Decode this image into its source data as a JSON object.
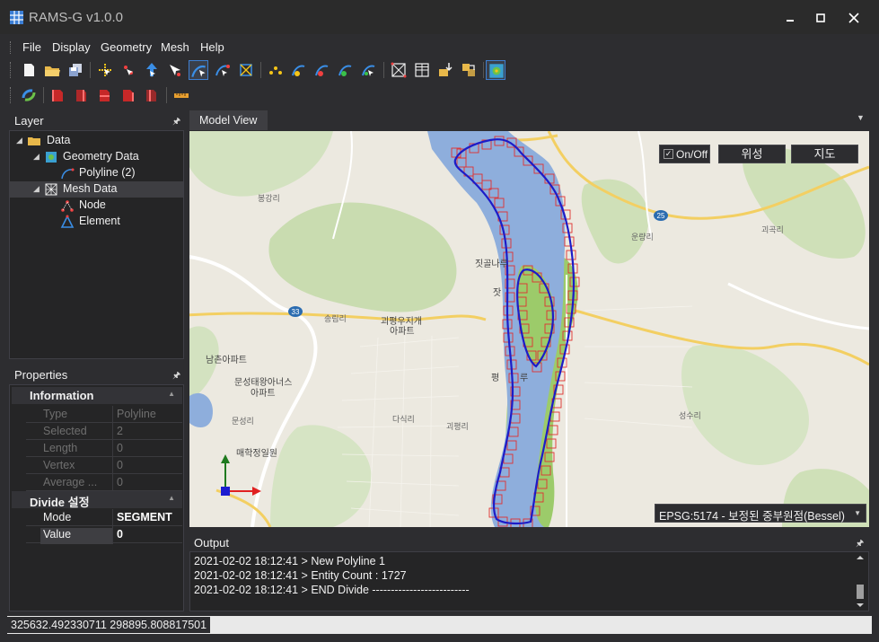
{
  "app": {
    "title": "RAMS-G v1.0.0",
    "window_controls": {
      "minimize": "minimize",
      "maximize": "maximize",
      "close": "close"
    }
  },
  "menu": {
    "file": "File",
    "display": "Display",
    "geometry": "Geometry",
    "mesh": "Mesh",
    "help": "Help"
  },
  "toolbar_icons_row1": [
    "new-file-icon",
    "open-folder-icon",
    "save-icon",
    "select-vertex-icon",
    "move-vertex-icon",
    "add-vertex-icon",
    "select-arrow-icon",
    "polyline-tool-icon",
    "edit-polyline-icon",
    "transform-icon",
    "node-add-icon",
    "curve-a-icon",
    "curve-b-icon",
    "curve-c-icon",
    "curve-d-icon",
    "grid-mesh-icon",
    "grid-refine-icon",
    "mesh-import-icon",
    "mesh-export-icon",
    "map-icon"
  ],
  "toolbar_icons_row2": [
    "refresh-icon",
    "red-box-1-icon",
    "red-box-2-icon",
    "red-box-3-icon",
    "red-box-4-icon",
    "red-box-5-icon",
    "ruler-icon"
  ],
  "layer_panel": {
    "title": "Layer",
    "tree": {
      "data": "Data",
      "geometry_data": "Geometry Data",
      "polyline": "Polyline (2)",
      "mesh_data": "Mesh Data",
      "node": "Node",
      "element": "Element"
    }
  },
  "properties_panel": {
    "title": "Properties",
    "information": {
      "label": "Information",
      "rows": [
        {
          "key": "Type",
          "value": "Polyline"
        },
        {
          "key": "Selected",
          "value": "2"
        },
        {
          "key": "Length",
          "value": "0"
        },
        {
          "key": "Vertex",
          "value": "0"
        },
        {
          "key": "Average ...",
          "value": "0"
        }
      ]
    },
    "divide": {
      "label": "Divide 설정",
      "rows": [
        {
          "key": "Mode",
          "value": "SEGMENT"
        },
        {
          "key": "Value",
          "value": "0"
        }
      ]
    }
  },
  "model_view": {
    "tab": "Model View",
    "onoff_label": "On/Off",
    "onoff_checked": "✓",
    "satellite_button": "위성",
    "map_button": "지도",
    "crs": "EPSG:5174 - 보정된 중부원점(Bessel)",
    "map_labels": {
      "bonggang": "봉강리",
      "unyang": "운량리",
      "gwagok": "괴곡리",
      "jitgol": "짓골나루",
      "jit2": "잣",
      "songrim": "송림리",
      "apt1_a": "괴평우지개",
      "apt1_b": "아파트",
      "namchon": "남촌아파트",
      "munsong_a": "문성태왕아너스",
      "munsong_b": "아파트",
      "pyeong": "평",
      "pyeong2": "루",
      "dasik": "다식리",
      "goepyeong": "괴평리",
      "munseong": "문성리",
      "maehak": "매학정일원",
      "seongsu": "성수리",
      "route33": "33",
      "route25": "25"
    }
  },
  "output_panel": {
    "title": "Output",
    "lines": [
      "2021-02-02 18:12:41 > New Polyline 1",
      "2021-02-02 18:12:41 > Entity Count : 1727",
      "2021-02-02 18:12:41 > END Divide --------------------------"
    ]
  },
  "status": {
    "coords": "325632.492330711 298895.808817501"
  },
  "colors": {
    "background": "#2d2d30",
    "panel": "#252526",
    "accent": "#3e7fd1",
    "river": "#8eaedc",
    "polyline": "#1c1cc8",
    "mesh_box": "#e03030"
  }
}
